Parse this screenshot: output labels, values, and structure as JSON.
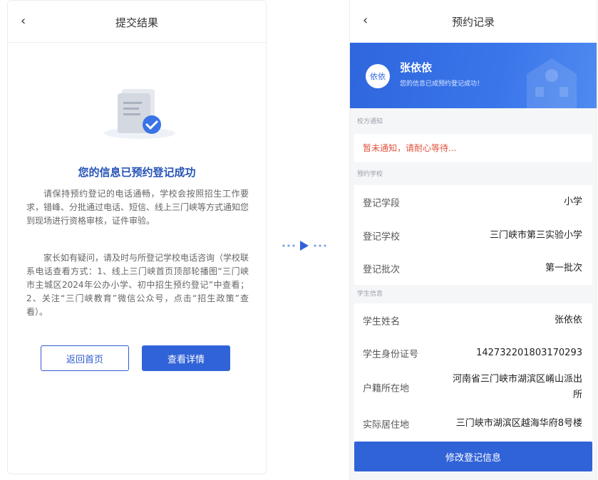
{
  "left": {
    "nav": {
      "back_icon": "‹",
      "title": "提交结果"
    },
    "success_title": "您的信息已预约登记成功",
    "paragraph_1": "请保持预约登记的电话通畅，学校会按照招生工作要求，错峰、分批通过电话、短信、线上三门峡等方式通知您到现场进行资格审核，证件审验。",
    "paragraph_2": "家长如有疑问，请及时与所登记学校电话咨询（学校联系电话查看方式：1、线上三门峡首页顶部轮播图“三门峡市主城区2024年公办小学、初中招生预约登记”中查看；2、关注“三门峡教育”微信公众号，点击“招生政策”查看）。",
    "buttons": {
      "home": "返回首页",
      "detail": "查看详情"
    }
  },
  "right": {
    "nav": {
      "back_icon": "‹",
      "title": "预约记录"
    },
    "banner": {
      "avatar": "依依",
      "name": "张依依",
      "subtitle": "您的信息已成预约登记成功！"
    },
    "section_notice": "校方通知",
    "notice_text": "暂未通知，请耐心等待...",
    "section_school": "预约学校",
    "school_rows": [
      {
        "label": "登记学段",
        "value": "小学"
      },
      {
        "label": "登记学校",
        "value": "三门峡市第三实验小学"
      },
      {
        "label": "登记批次",
        "value": "第一批次"
      }
    ],
    "section_student": "学生信息",
    "student_rows": [
      {
        "label": "学生姓名",
        "value": "张依依"
      },
      {
        "label": "学生身份证号",
        "value": "142732201803170293"
      },
      {
        "label": "户籍所在地",
        "value": "河南省三门峡市湖滨区崤山派出所"
      },
      {
        "label": "实际居住地",
        "value": "三门峡市湖滨区越海华府8号楼"
      }
    ],
    "submit_label": "修改登记信息"
  },
  "colors": {
    "accent": "#3163d8",
    "title_blue": "#2653b8",
    "notice_red": "#e0533f"
  }
}
